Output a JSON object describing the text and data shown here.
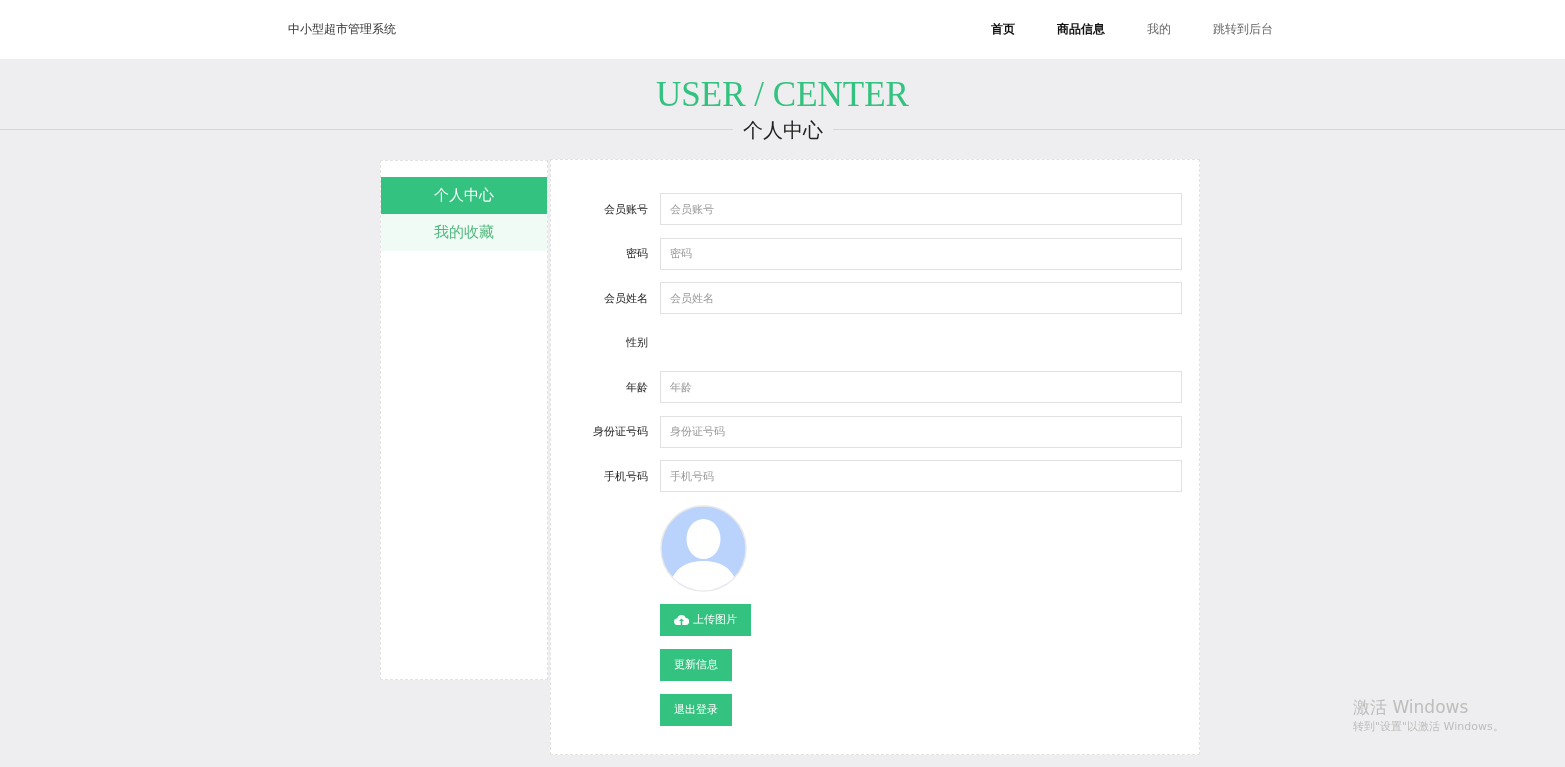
{
  "header": {
    "site_title": "中小型超市管理系统",
    "nav": [
      {
        "label": "首页",
        "bold": true
      },
      {
        "label": "商品信息",
        "bold": true
      },
      {
        "label": "我的",
        "bold": false
      },
      {
        "label": "跳转到后台",
        "bold": false
      }
    ]
  },
  "page_title": {
    "english": "USER / CENTER",
    "chinese": "个人中心"
  },
  "sidebar": {
    "items": [
      {
        "label": "个人中心",
        "selected": true,
        "hovered": false
      },
      {
        "label": "我的收藏",
        "selected": false,
        "hovered": true
      }
    ]
  },
  "form": {
    "fields": [
      {
        "label": "会员账号",
        "kind": "input",
        "placeholder": "会员账号"
      },
      {
        "label": "密码",
        "kind": "input",
        "placeholder": "密码"
      },
      {
        "label": "会员姓名",
        "kind": "input",
        "placeholder": "会员姓名"
      },
      {
        "label": "性别",
        "kind": "empty"
      },
      {
        "label": "年龄",
        "kind": "input",
        "placeholder": "年龄"
      },
      {
        "label": "身份证号码",
        "kind": "input",
        "placeholder": "身份证号码"
      },
      {
        "label": "手机号码",
        "kind": "input",
        "placeholder": "手机号码"
      }
    ],
    "upload_button": "上传图片",
    "buttons": [
      "更新信息",
      "退出登录"
    ]
  },
  "os_notice": {
    "title": "激活 Windows",
    "text": "转到\"设置\"以激活 Windows。"
  }
}
